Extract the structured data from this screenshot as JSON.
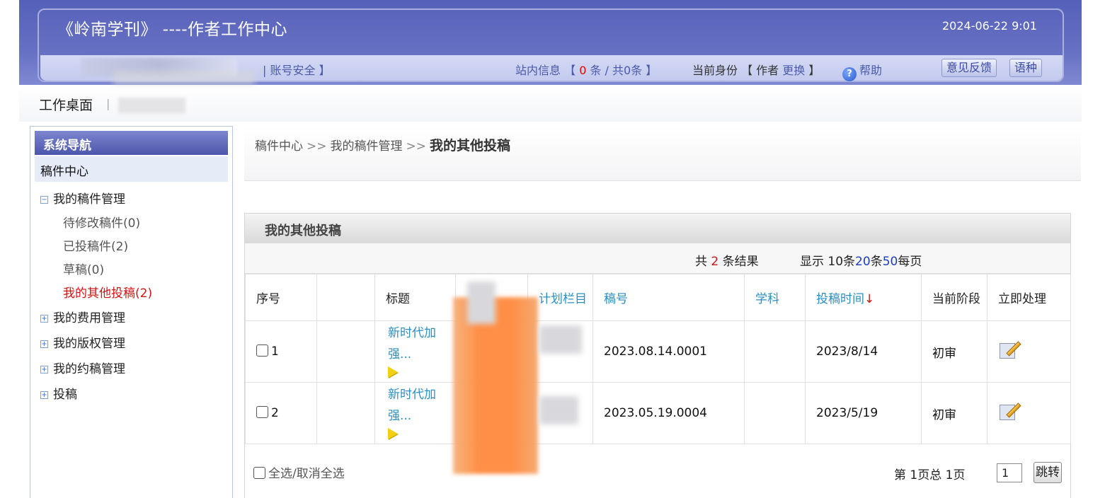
{
  "header": {
    "title": "《岭南学刊》 ----作者工作中心",
    "datetime": "2024-06-22 9:01",
    "account_security": "| 账号安全 】",
    "site_msg_label": "站内信息 【",
    "site_msg_count": "0",
    "site_msg_rest": "条 / 共0条 】",
    "identity_label": "当前身份 【 作者",
    "identity_switch": "更换",
    "identity_close": "】",
    "help_label": "帮助",
    "help_icon": "?",
    "feedback_button": "意见反馈",
    "language_button": "语种"
  },
  "desk": {
    "title": "工作桌面",
    "separator": "|"
  },
  "sidebar": {
    "heading": "系统导航",
    "section": "稿件中心",
    "groups": [
      {
        "label": "我的稿件管理",
        "toggle": "−"
      },
      {
        "label": "我的费用管理",
        "toggle": "+"
      },
      {
        "label": "我的版权管理",
        "toggle": "+"
      },
      {
        "label": "我的约稿管理",
        "toggle": "+"
      },
      {
        "label": "投稿",
        "toggle": "+"
      }
    ],
    "sub_items": [
      "待修改稿件(0)",
      "已投稿件(2)",
      "草稿(0)",
      "我的其他投稿(2)"
    ]
  },
  "breadcrumb": {
    "items": [
      "稿件中心",
      "我的稿件管理"
    ],
    "separator": ">>",
    "current": "我的其他投稿"
  },
  "panel": {
    "title": "我的其他投稿",
    "results": {
      "prefix": "共",
      "count": "2",
      "suffix": "条结果"
    },
    "page_size": {
      "prefix": "显示 10条",
      "opt20": "20",
      "mid": "条",
      "opt50": "50",
      "suffix": "每页"
    },
    "columns": [
      "序号",
      "",
      "标题",
      "",
      "",
      "计划栏目",
      "稿号",
      "学科",
      "投稿时间",
      "当前阶段",
      "立即处理"
    ],
    "sort_arrow": "↓",
    "rows": [
      {
        "index": "1",
        "title_line1": "新时代加",
        "title_line2": "强...",
        "manuscript_no": "2023.08.14.0001",
        "date": "2023/8/14",
        "stage": "初审"
      },
      {
        "index": "2",
        "title_line1": "新时代加",
        "title_line2": "强...",
        "manuscript_no": "2023.05.19.0004",
        "date": "2023/5/19",
        "stage": "初审"
      }
    ],
    "select_all": "全选/取消全选",
    "pagination": {
      "info": "第 1页总 1页",
      "page_input": "1",
      "jump_button": "跳转"
    }
  }
}
